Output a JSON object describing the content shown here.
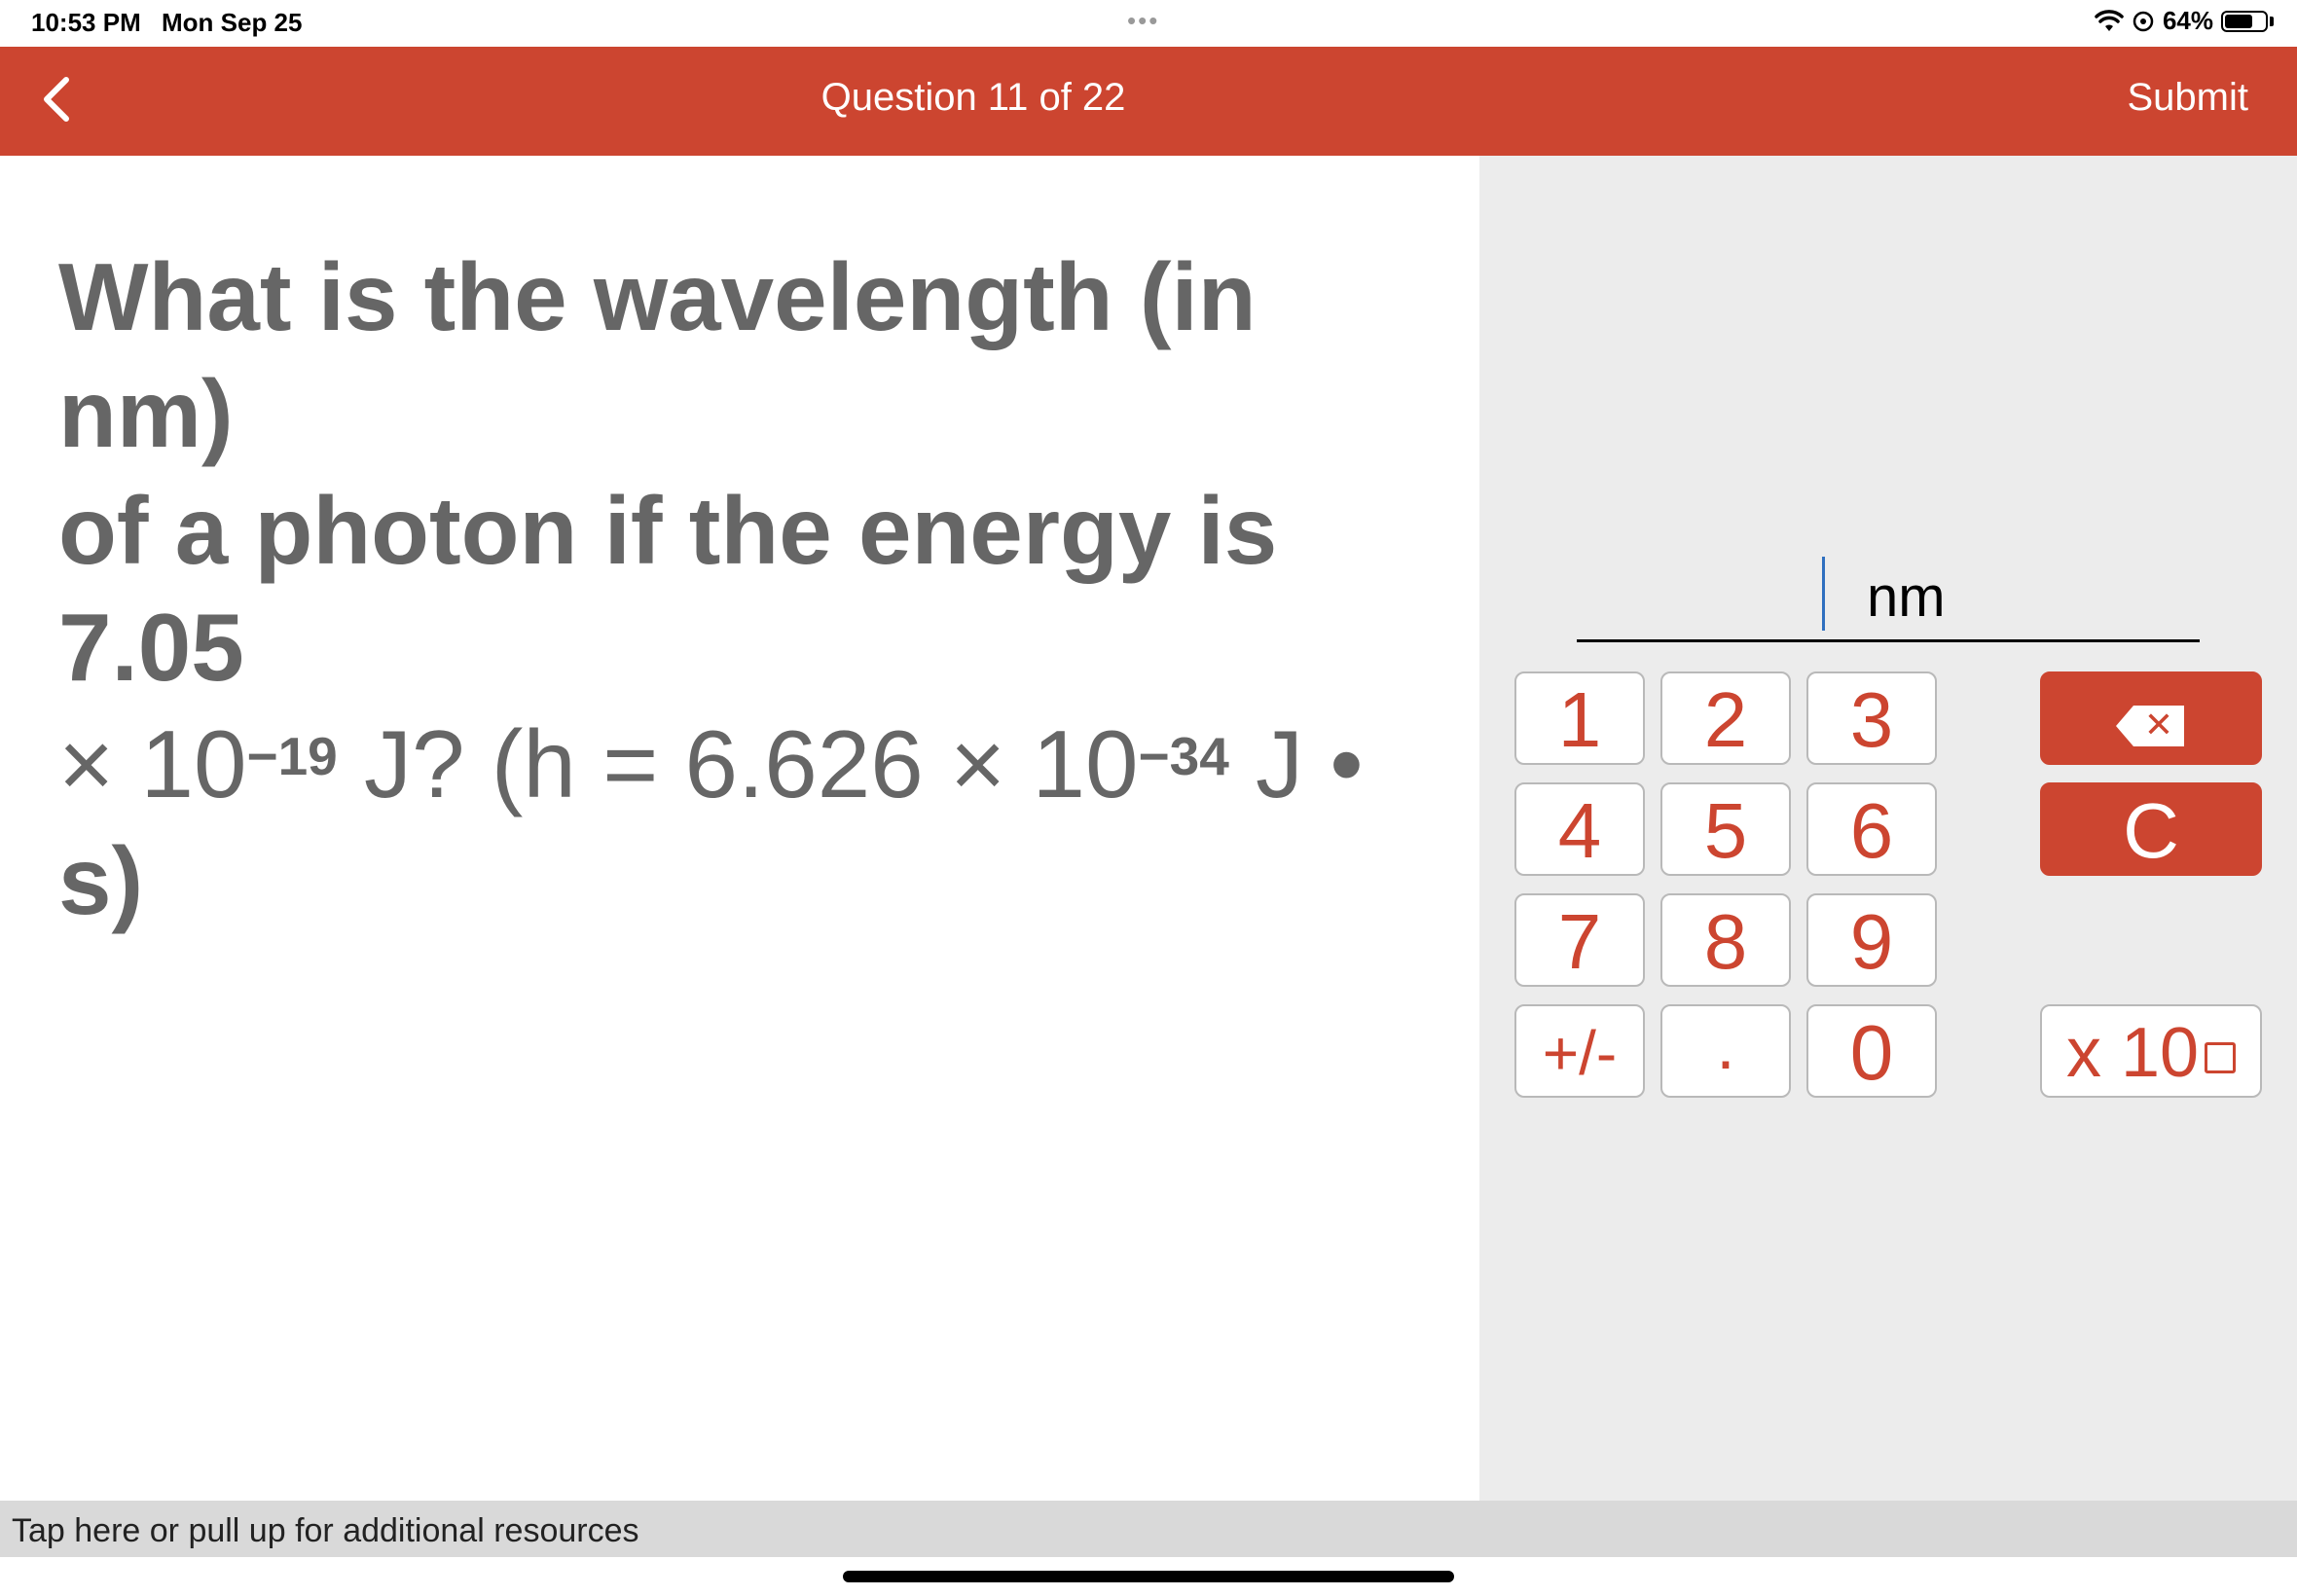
{
  "status_bar": {
    "time": "10:53 PM",
    "date": "Mon Sep 25",
    "dots": "•••",
    "battery": "64%",
    "icons": [
      "wifi-icon",
      "location-icon",
      "battery-icon"
    ]
  },
  "header": {
    "title": "Question 11 of 22",
    "submit_label": "Submit",
    "back_icon": "chevron-left-icon",
    "background": "#cc4530"
  },
  "question": {
    "line1": "What is the wavelength (in nm)",
    "line2": "of a photon if the energy is 7.05",
    "line3_a": "× 10",
    "line3_exp1": "−19",
    "line3_b": " J?  (h = 6.626 × 10",
    "line3_exp2": "−34",
    "line3_c": " J •",
    "line4": "s)"
  },
  "answer": {
    "value": "",
    "unit": "nm"
  },
  "keypad": {
    "keys": [
      "1",
      "2",
      "3",
      "4",
      "5",
      "6",
      "7",
      "8",
      "9",
      "+/-",
      ".",
      "0"
    ],
    "backspace_icon": "backspace-icon",
    "backspace_glyph": "✕",
    "clear_label": "C",
    "exponent_label": "x 10"
  },
  "footer": {
    "resources_text": "Tap here or pull up for additional resources"
  },
  "colors": {
    "accent": "#cc4530",
    "panel_bg": "#ececec",
    "question_text": "#666666",
    "cursor": "#2f6fbf"
  }
}
